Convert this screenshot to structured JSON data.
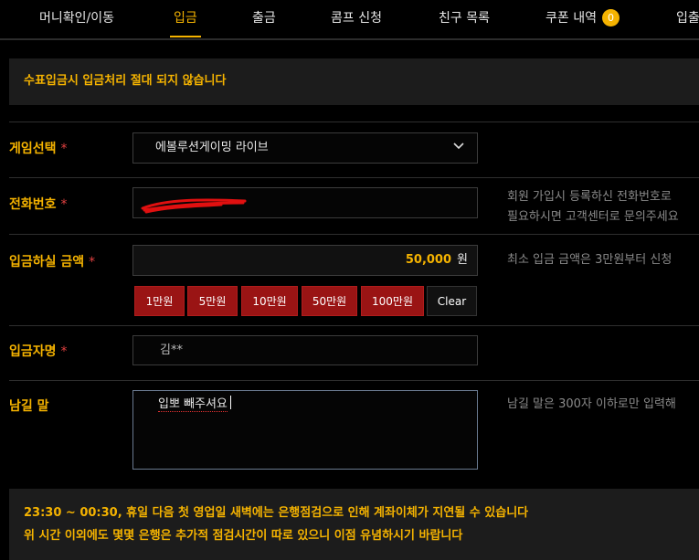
{
  "tabs": [
    {
      "label": "머니확인/이동"
    },
    {
      "label": "입금"
    },
    {
      "label": "출금"
    },
    {
      "label": "콤프 신청"
    },
    {
      "label": "친구 목록"
    },
    {
      "label": "쿠폰 내역",
      "badge": "0"
    },
    {
      "label": "입출"
    }
  ],
  "notice_top": "수표입금시 입금처리 절대 되지 않습니다",
  "form": {
    "game": {
      "label": "게임선택",
      "required": "*",
      "value": "에볼루션게이밍 라이브"
    },
    "phone": {
      "label": "전화번호",
      "required": "*",
      "help1": "회원 가입시 등록하신 전화번호로",
      "help2": "필요하시면 고객센터로 문의주세요"
    },
    "amount": {
      "label": "입금하실 금액",
      "required": "*",
      "value": "50,000",
      "unit": "원",
      "help": "최소 입금 금액은 3만원부터 신청"
    },
    "quick_buttons": [
      "1만원",
      "5만원",
      "10만원",
      "50만원",
      "100만원",
      "Clear"
    ],
    "depositor": {
      "label": "입금자명",
      "required": "*",
      "value": "김**"
    },
    "memo": {
      "label": "남길 말",
      "value": "입뽀 빼주셔요",
      "help": "남길 말은 300자 이하로만 입력해"
    }
  },
  "notice_bottom": {
    "line1": "23:30 ~ 00:30, 휴일 다음 첫 영업일 새벽에는 은행점검으로 인해 계좌이체가 지연될 수 있습니다",
    "line2": "위 시간 이외에도 몇몇 은행은 추가적 점검시간이 따로 있으니 이점 유념하시기 바랍니다"
  },
  "colors": {
    "accent": "#f5b300",
    "button_red": "#9a1414",
    "required": "#e04040"
  },
  "icons": {
    "select": "chevron-down-icon"
  }
}
